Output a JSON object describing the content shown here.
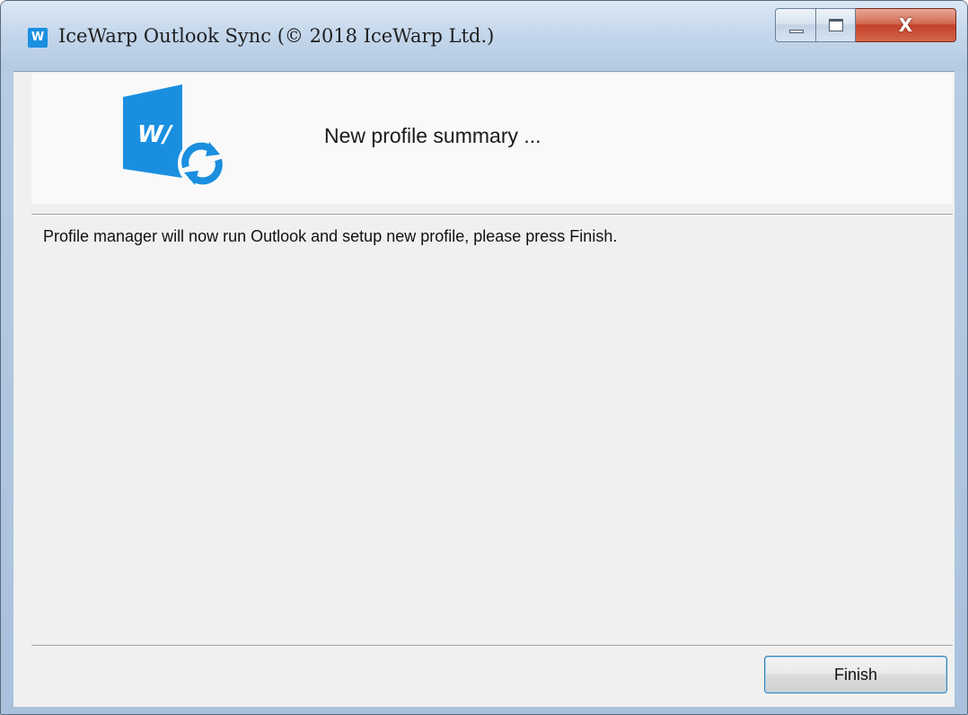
{
  "window": {
    "title": "IceWarp Outlook Sync (© 2018 IceWarp Ltd.)",
    "app_icon_letter": "W",
    "caption_buttons": {
      "minimize": "minimize",
      "maximize": "maximize",
      "close": "X"
    }
  },
  "header": {
    "title": "New profile summary ...",
    "logo_mark": "W/",
    "logo_color": "#1a8fe0"
  },
  "body": {
    "message": "Profile manager will now run Outlook and setup new profile, please press Finish."
  },
  "footer": {
    "finish_label": "Finish"
  }
}
